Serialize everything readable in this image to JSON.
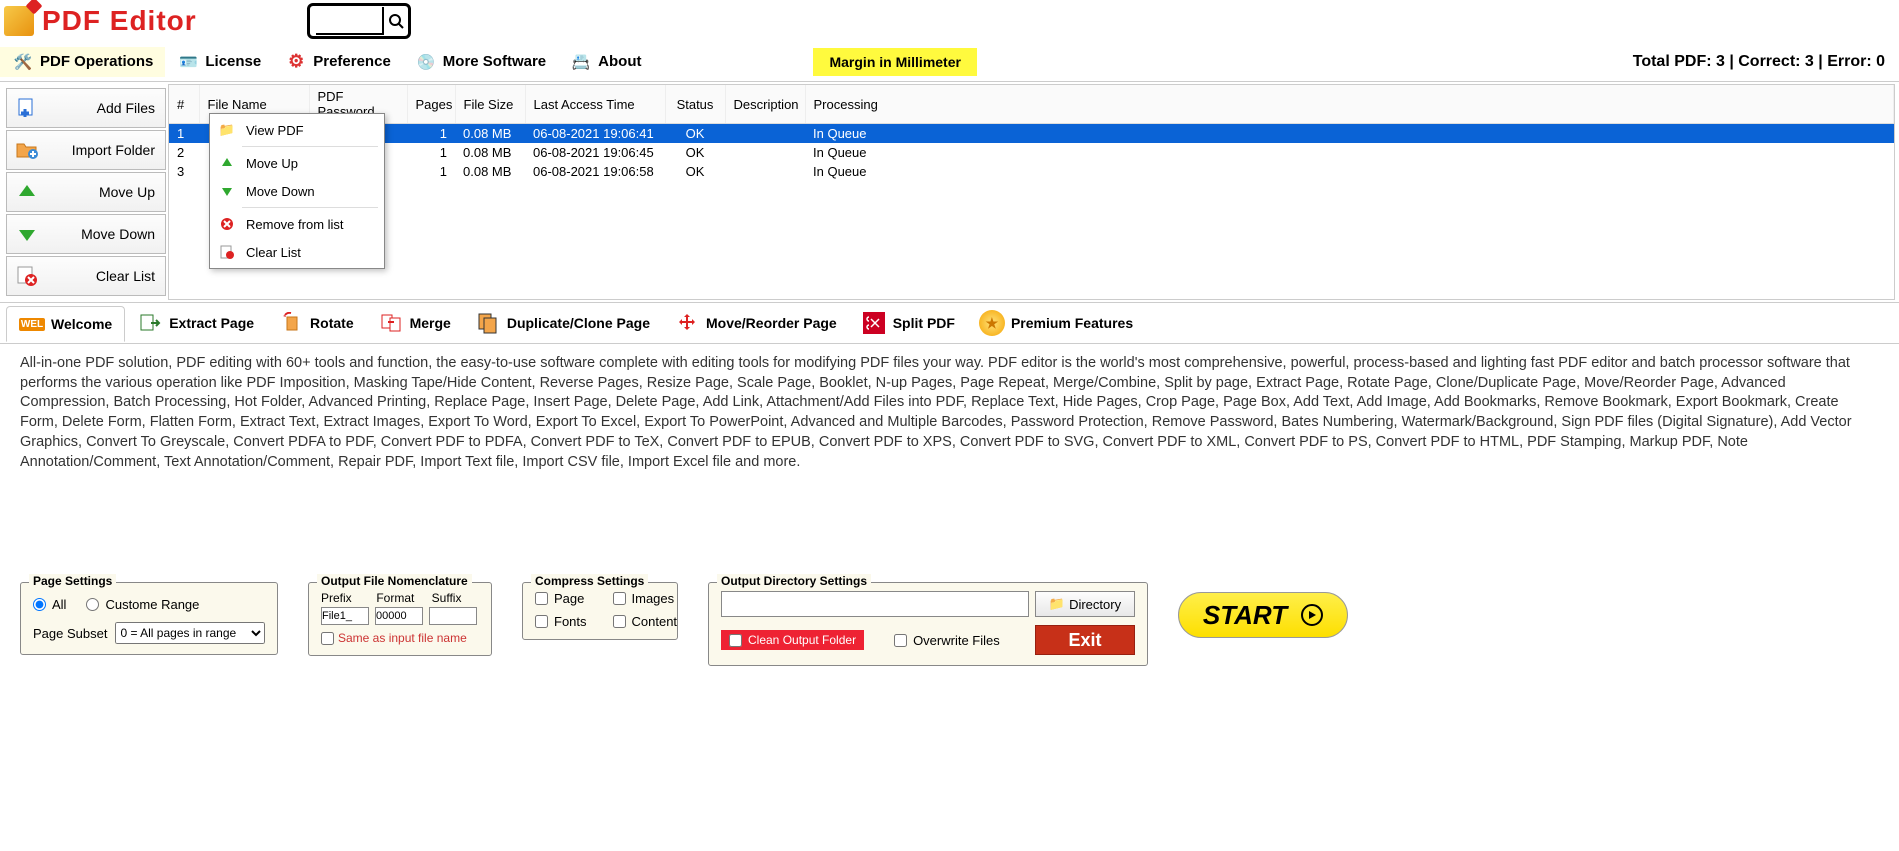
{
  "app": {
    "title": "PDF Editor"
  },
  "menu": {
    "pdf_operations": "PDF Operations",
    "license": "License",
    "preference": "Preference",
    "more_software": "More Software",
    "about": "About",
    "margin_badge": "Margin in Millimeter"
  },
  "status_bar": {
    "text": "Total PDF: 3  |  Correct: 3  |  Error: 0"
  },
  "sidebar": {
    "add_files": "Add Files",
    "import_folder": "Import Folder",
    "move_up": "Move Up",
    "move_down": "Move Down",
    "clear_list": "Clear List"
  },
  "grid": {
    "headers": {
      "idx": "#",
      "file_name": "File Name",
      "pdf_password": "PDF Password",
      "pages": "Pages",
      "file_size": "File Size",
      "last_access": "Last Access Time",
      "status": "Status",
      "description": "Description",
      "processing": "Processing"
    },
    "rows": [
      {
        "idx": "1",
        "file_name": "",
        "pages": "1",
        "file_size": "0.08 MB",
        "last_access": "06-08-2021 19:06:41",
        "status": "OK",
        "processing": "In Queue",
        "selected": true
      },
      {
        "idx": "2",
        "file_name": "",
        "pages": "1",
        "file_size": "0.08 MB",
        "last_access": "06-08-2021 19:06:45",
        "status": "OK",
        "processing": "In Queue",
        "selected": false
      },
      {
        "idx": "3",
        "file_name": "",
        "pages": "1",
        "file_size": "0.08 MB",
        "last_access": "06-08-2021 19:06:58",
        "status": "OK",
        "processing": "In Queue",
        "selected": false
      }
    ]
  },
  "context_menu": {
    "view_pdf": "View PDF",
    "move_up": "Move Up",
    "move_down": "Move Down",
    "remove": "Remove from list",
    "clear": "Clear List"
  },
  "tabs": {
    "welcome": "Welcome",
    "extract_page": "Extract Page",
    "rotate": "Rotate",
    "merge": "Merge",
    "duplicate": "Duplicate/Clone Page",
    "move_reorder": "Move/Reorder Page",
    "split": "Split PDF",
    "premium": "Premium Features"
  },
  "welcome_text": "All-in-one PDF solution, PDF editing with 60+ tools and function, the easy-to-use software complete with editing tools for modifying PDF files your way. PDF editor is the world's most comprehensive, powerful, process-based and lighting fast PDF editor and batch processor software that performs the various operation like PDF Imposition, Masking Tape/Hide Content, Reverse Pages, Resize Page, Scale Page, Booklet, N-up Pages, Page Repeat, Merge/Combine, Split by page, Extract Page, Rotate Page, Clone/Duplicate Page, Move/Reorder Page, Advanced Compression, Batch Processing, Hot Folder, Advanced Printing, Replace Page, Insert Page, Delete Page, Add Link, Attachment/Add Files into PDF, Replace Text, Hide Pages, Crop Page, Page Box, Add Text, Add Image, Add Bookmarks, Remove Bookmark, Export Bookmark, Create Form, Delete Form, Flatten Form, Extract Text, Extract Images, Export To Word, Export To Excel, Export To PowerPoint, Advanced and Multiple Barcodes, Password Protection, Remove Password, Bates Numbering,  Watermark/Background, Sign PDF files (Digital Signature), Add Vector Graphics, Convert To Greyscale, Convert PDFA to PDF, Convert PDF to PDFA, Convert PDF to TeX, Convert PDF to EPUB, Convert PDF to XPS, Convert PDF to SVG, Convert PDF to XML, Convert PDF to PS, Convert PDF to HTML, PDF Stamping, Markup PDF, Note Annotation/Comment, Text Annotation/Comment, Repair PDF, Import Text file, Import CSV file, Import Excel file and more.",
  "settings": {
    "page": {
      "legend": "Page Settings",
      "all": "All",
      "custom": "Custome Range",
      "subset_label": "Page Subset",
      "subset_value": "0 = All pages in range"
    },
    "nomen": {
      "legend": "Output File Nomenclature",
      "prefix_label": "Prefix",
      "format_label": "Format",
      "suffix_label": "Suffix",
      "prefix_value": "File1_",
      "format_value": "00000",
      "suffix_value": "",
      "same": "Same as input file name"
    },
    "compress": {
      "legend": "Compress Settings",
      "page": "Page",
      "images": "Images",
      "fonts": "Fonts",
      "content": "Content"
    },
    "outdir": {
      "legend": "Output Directory Settings",
      "directory_btn": "Directory",
      "clean": "Clean Output Folder",
      "overwrite": "Overwrite Files"
    },
    "exit": "Exit",
    "start": "START"
  }
}
